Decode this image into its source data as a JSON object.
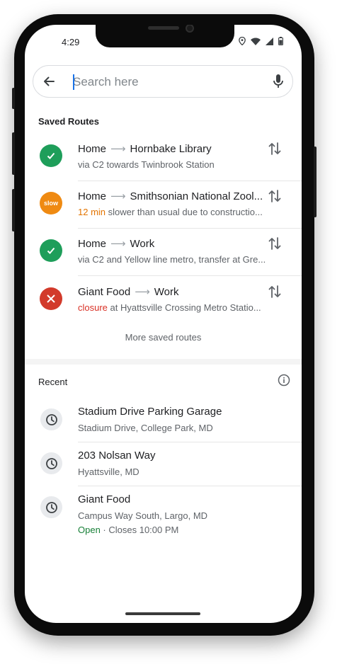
{
  "status_bar": {
    "time": "4:29"
  },
  "search": {
    "placeholder": "Search here"
  },
  "saved_routes": {
    "heading": "Saved Routes",
    "routes": [
      {
        "from": "Home",
        "to": "Hornbake Library",
        "status": "ok",
        "detail": "via C2 towards Twinbrook Station"
      },
      {
        "from": "Home",
        "to": "Smithsonian National Zool...",
        "status": "slow",
        "badge_text": "slow",
        "highlight": "12 min",
        "detail": " slower than usual due to constructio..."
      },
      {
        "from": "Home",
        "to": "Work",
        "status": "ok",
        "detail": "via C2 and Yellow line metro, transfer at Gre..."
      },
      {
        "from": "Giant Food",
        "to": "Work",
        "status": "closed",
        "highlight": "closure",
        "detail": " at Hyattsville Crossing Metro Statio..."
      }
    ],
    "more_label": "More saved routes"
  },
  "recent": {
    "heading": "Recent",
    "items": [
      {
        "name": "Stadium Drive Parking Garage",
        "address": "Stadium Drive, College Park, MD"
      },
      {
        "name": "203 Nolsan Way",
        "address": "Hyattsville, MD"
      },
      {
        "name": "Giant Food",
        "address": "Campus Way South, Largo, MD",
        "open_label": "Open",
        "hours": " · Closes 10:00 PM"
      }
    ]
  },
  "colors": {
    "ok": "#1e9e5a",
    "slow": "#ef8a12",
    "closed": "#d23a2b",
    "open": "#188038"
  }
}
